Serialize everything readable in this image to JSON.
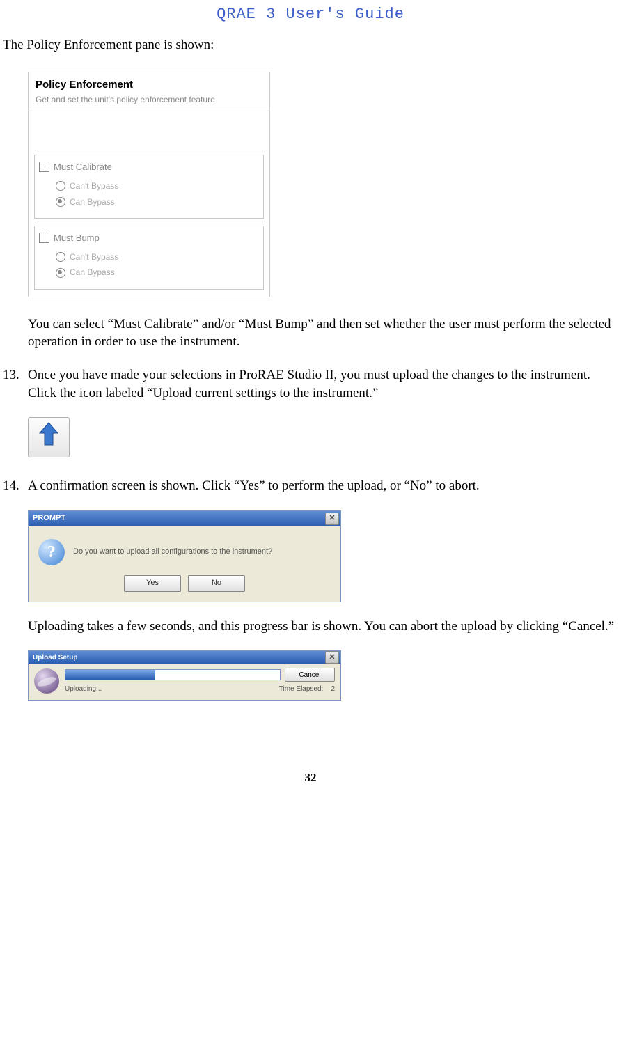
{
  "header": "QRAE 3 User's Guide",
  "intro": "The Policy Enforcement pane is shown:",
  "pe": {
    "title": "Policy Enforcement",
    "sub": "Get and set the unit's policy enforcement feature",
    "groups": [
      {
        "label": "Must Calibrate",
        "radios": [
          "Can't Bypass",
          "Can Bypass"
        ],
        "selected": 1
      },
      {
        "label": "Must Bump",
        "radios": [
          "Can't Bypass",
          "Can Bypass"
        ],
        "selected": 1
      }
    ]
  },
  "para1": "You can select “Must Calibrate” and/or “Must Bump” and then set whether the user must perform the selected operation in order to use the instrument.",
  "step13_num": "13.",
  "step13": "Once you have made your selections in ProRAE Studio II, you must upload the changes to the instrument. Click the icon labeled “Upload current settings to the instrument.”",
  "step14_num": "14.",
  "step14": "A confirmation screen is shown. Click “Yes” to perform the upload, or “No” to abort.",
  "prompt": {
    "title": "PROMPT",
    "msg": "Do you want to upload all configurations to the instrument?",
    "yes": "Yes",
    "no": "No"
  },
  "para2": "Uploading takes a few seconds, and this progress bar is shown. You can abort the upload by clicking “Cancel.”",
  "upload_setup": {
    "title": "Upload Setup",
    "status": "Uploading...",
    "time_label": "Time Elapsed:",
    "time_val": "2",
    "cancel": "Cancel"
  },
  "page_number": "32"
}
